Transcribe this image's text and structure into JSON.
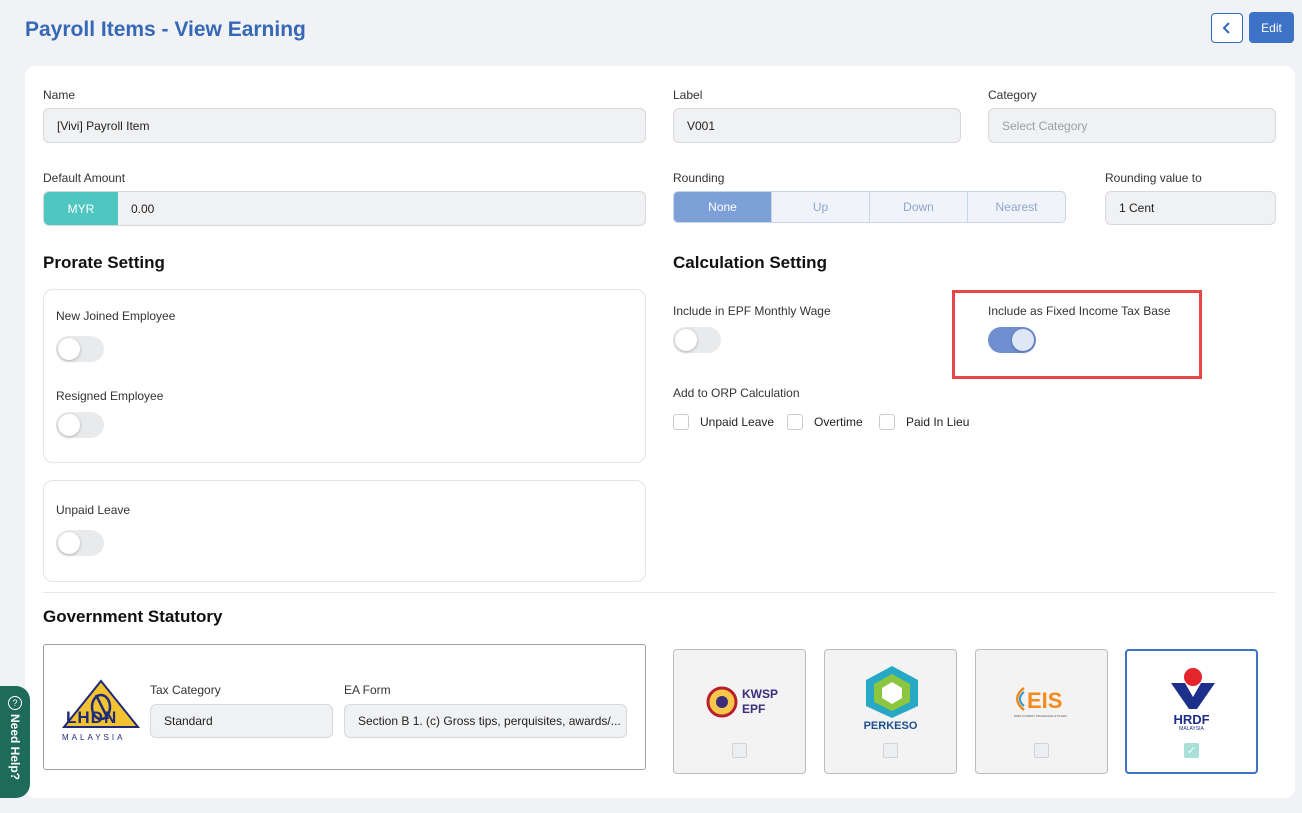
{
  "header": {
    "title": "Payroll Items - View Earning",
    "back_icon": "chevron-left-icon",
    "edit_label": "Edit"
  },
  "form": {
    "name_label": "Name",
    "name_value": "[Vivi] Payroll Item",
    "label_label": "Label",
    "label_value": "V001",
    "category_label": "Category",
    "category_placeholder": "Select Category",
    "default_amount_label": "Default Amount",
    "currency": "MYR",
    "amount_value": "0.00",
    "rounding_label": "Rounding",
    "rounding_options": [
      "None",
      "Up",
      "Down",
      "Nearest"
    ],
    "rounding_selected": "None",
    "rounding_value_label": "Rounding value to",
    "rounding_value": "1 Cent"
  },
  "prorate": {
    "title": "Prorate Setting",
    "new_joined_label": "New Joined Employee",
    "new_joined_on": false,
    "resigned_label": "Resigned Employee",
    "resigned_on": false,
    "unpaid_leave_label": "Unpaid Leave",
    "unpaid_leave_on": false
  },
  "calculation": {
    "title": "Calculation Setting",
    "epf_label": "Include in EPF Monthly Wage",
    "epf_on": false,
    "fixed_tax_label": "Include as Fixed Income Tax Base",
    "fixed_tax_on": true,
    "orp_label": "Add to ORP Calculation",
    "orp_options": [
      "Unpaid Leave",
      "Overtime",
      "Paid In Lieu"
    ]
  },
  "statutory": {
    "title": "Government Statutory",
    "lhdn_logo_text": "LHDN",
    "lhdn_logo_sub": "MALAYSIA",
    "tax_category_label": "Tax Category",
    "tax_category_value": "Standard",
    "ea_form_label": "EA Form",
    "ea_form_value": "Section B 1. (c) Gross tips, perquisites, awards/...",
    "cards": [
      {
        "name": "KWSP EPF",
        "line1": "KWSP",
        "line2": "EPF",
        "checked": false
      },
      {
        "name": "PERKESO",
        "line1": "PERKESO",
        "checked": false
      },
      {
        "name": "EIS",
        "line1": "EIS",
        "line2": "EMPLOYMENT INSURANCE SYSTEM",
        "checked": false
      },
      {
        "name": "HRDF",
        "line1": "HRDF",
        "line2": "MALAYSIA",
        "checked": true
      }
    ]
  },
  "help": {
    "label": "Need Help?",
    "icon": "question-circle-icon"
  },
  "colors": {
    "brand": "#3568b5",
    "accent_teal": "#4fc6c0",
    "highlight": "#e8474a"
  }
}
